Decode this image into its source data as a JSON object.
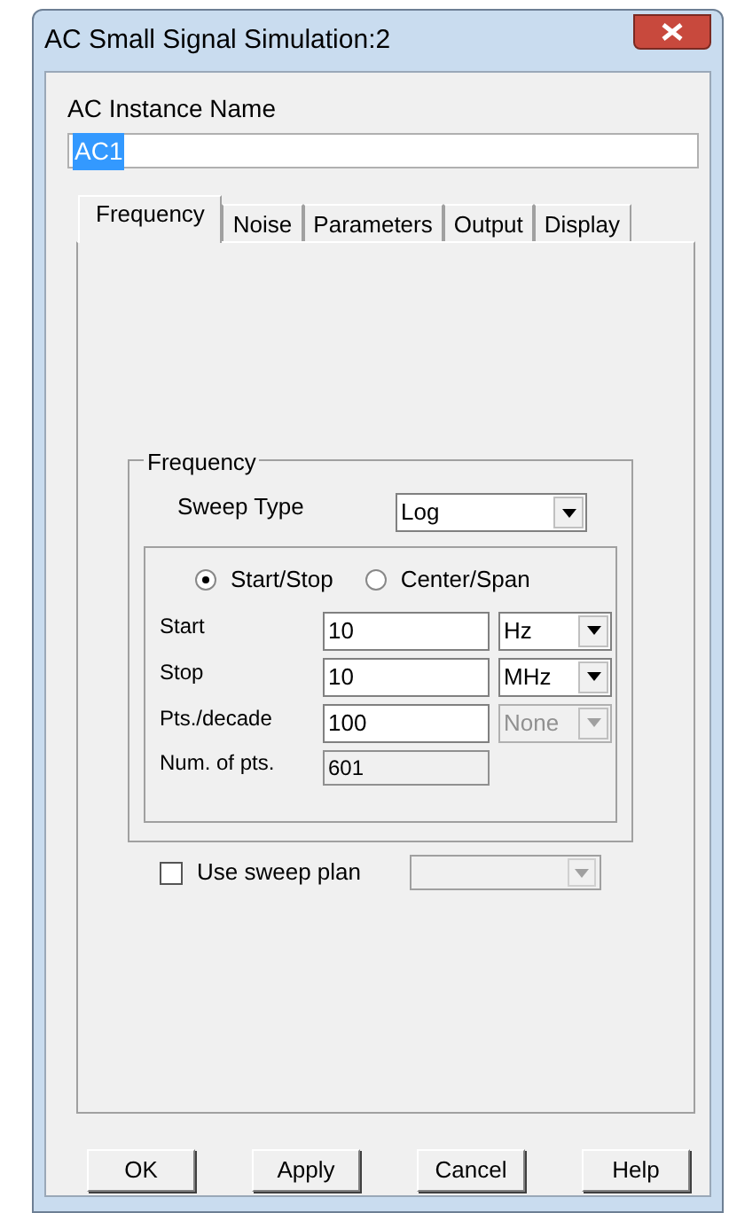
{
  "window": {
    "title": "AC Small Signal Simulation:2"
  },
  "instance_name": {
    "label": "AC Instance Name",
    "value": "AC1",
    "value_selected": true
  },
  "tabs": [
    {
      "label": "Frequency",
      "selected": true
    },
    {
      "label": "Noise",
      "selected": false
    },
    {
      "label": "Parameters",
      "selected": false
    },
    {
      "label": "Output",
      "selected": false
    },
    {
      "label": "Display",
      "selected": false
    }
  ],
  "frequency_group": {
    "title": "Frequency",
    "sweep_type": {
      "label": "Sweep Type",
      "value": "Log"
    },
    "modes": [
      {
        "label": "Start/Stop",
        "selected": true
      },
      {
        "label": "Center/Span",
        "selected": false
      }
    ],
    "rows": [
      {
        "label": "Start",
        "value": "10",
        "unit": "Hz",
        "unit_disabled": false
      },
      {
        "label": "Stop",
        "value": "10",
        "unit": "MHz",
        "unit_disabled": false
      },
      {
        "label": "Pts./decade",
        "value": "100",
        "unit": "None",
        "unit_disabled": true
      }
    ],
    "num_points": {
      "label": "Num. of pts.",
      "value": "601"
    }
  },
  "sweep_plan": {
    "label": "Use sweep plan",
    "checked": false
  },
  "buttons": [
    "OK",
    "Apply",
    "Cancel",
    "Help"
  ]
}
